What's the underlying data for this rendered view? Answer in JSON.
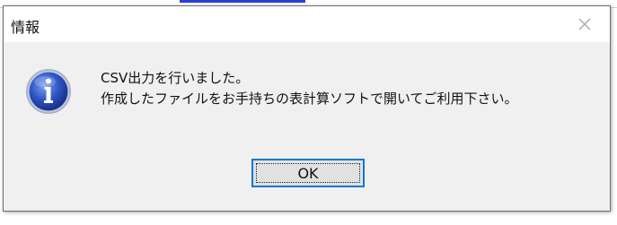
{
  "dialog": {
    "title": "情報",
    "message_line1": "CSV出力を行いました。",
    "message_line2": "作成したファイルをお手持ちの表計算ソフトで開いてご利用下さい。",
    "ok_label": "OK",
    "icon": "information-icon",
    "close_icon": "close-icon"
  },
  "colors": {
    "accent": "#0078d7",
    "dialog_bg": "#f0f0f0",
    "title_bg": "#ffffff",
    "icon_blue": "#2f57c7"
  }
}
